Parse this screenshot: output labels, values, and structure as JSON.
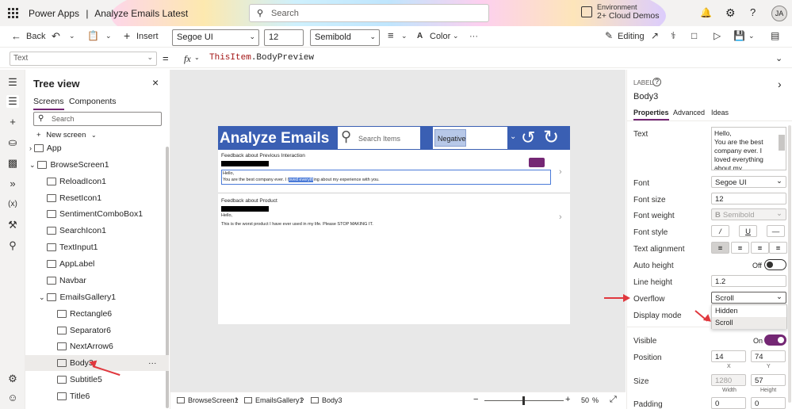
{
  "titlebar": {
    "app": "Power Apps",
    "sep": "|",
    "doc": "Analyze Emails Latest",
    "search_placeholder": "Search",
    "env_label": "Environment",
    "env_value": "2+ Cloud Demos",
    "avatar": "JA"
  },
  "cmdbar": {
    "back": "Back",
    "insert": "Insert",
    "font": "Segoe UI",
    "size": "12",
    "weight": "Semibold",
    "color": "Color",
    "more": "···",
    "editing": "Editing"
  },
  "formula": {
    "property": "Text",
    "fx": "fx",
    "expr_obj": "ThisItem",
    "expr_prop": ".BodyPreview"
  },
  "tree": {
    "title": "Tree view",
    "tab_screens": "Screens",
    "tab_components": "Components",
    "search_placeholder": "Search",
    "new_screen": "New screen",
    "items": [
      "App",
      "BrowseScreen1",
      "ReloadIcon1",
      "ResetIcon1",
      "SentimentComboBox1",
      "SearchIcon1",
      "TextInput1",
      "AppLabel",
      "Navbar",
      "EmailsGallery1",
      "Rectangle6",
      "Separator6",
      "NextArrow6",
      "Body3",
      "Subtitle5",
      "Title6"
    ],
    "more": "···"
  },
  "screen": {
    "title": "Analyze Emails",
    "search_placeholder": "Search Items",
    "combo": "Negative",
    "item1": {
      "title": "Feedback about Previous Interaction",
      "hello": "Hello,",
      "body_a": "You are the best company ever. I l",
      "body_sel": "oved everyth",
      "body_b": "ing about my experience with you."
    },
    "item2": {
      "title": "Feedback about Product",
      "hello": "Hello,",
      "body": "This is the worst product I have ever used in my life. Please STOP MAKING IT."
    }
  },
  "status": {
    "screen": "BrowseScreen1",
    "gallery": "EmailsGallery1",
    "control": "Body3",
    "zoom": "50",
    "pct": "%"
  },
  "props": {
    "type": "LABEL",
    "name": "Body3",
    "tabs": [
      "Properties",
      "Advanced",
      "Ideas"
    ],
    "text_label": "Text",
    "text_value": "Hello,\nYou are the best company ever. I loved everything about my experience with you.",
    "font_label": "Font",
    "font": "Segoe UI",
    "fontsize_label": "Font size",
    "fontsize": "12",
    "weight_label": "Font weight",
    "weight": "Semibold",
    "style_label": "Font style",
    "italic": "/",
    "underline": "U",
    "strike": "—",
    "align_label": "Text alignment",
    "autoh_label": "Auto height",
    "autoh": "Off",
    "lineh_label": "Line height",
    "lineh": "1.2",
    "overflow_label": "Overflow",
    "overflow": "Scroll",
    "overflow_options": [
      "Hidden",
      "Scroll"
    ],
    "display_label": "Display mode",
    "visible_label": "Visible",
    "visible": "On",
    "position_label": "Position",
    "x": "14",
    "y": "74",
    "x_cap": "X",
    "y_cap": "Y",
    "size_label": "Size",
    "width": "1280",
    "height": "57",
    "w_cap": "Width",
    "h_cap": "Height",
    "padding_label": "Padding",
    "pad1": "0",
    "pad2": "0"
  },
  "colors": {
    "accent": "#742774",
    "navbar": "#3a5fb3",
    "arrow": "#e0383e"
  }
}
